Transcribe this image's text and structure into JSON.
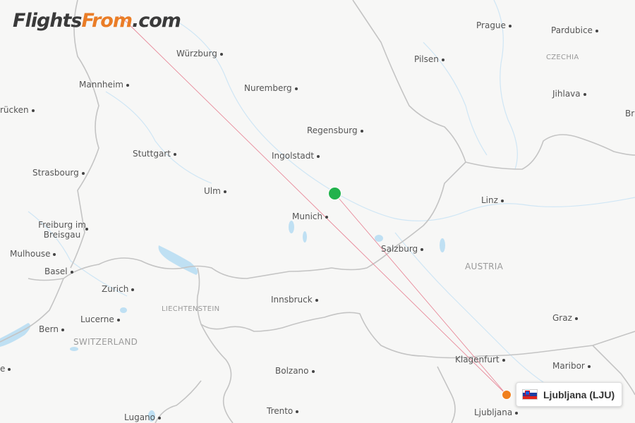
{
  "logo": {
    "part1": "Flights",
    "part2": "From",
    "part3": ".com"
  },
  "cities": [
    {
      "name": "Würzburg"
    },
    {
      "name": "Mannheim"
    },
    {
      "name": "Nuremberg"
    },
    {
      "name": "rücken"
    },
    {
      "name": "Regensburg"
    },
    {
      "name": "Stuttgart"
    },
    {
      "name": "Ingolstadt"
    },
    {
      "name": "Strasbourg"
    },
    {
      "name": "Ulm"
    },
    {
      "name": "Munich"
    },
    {
      "name": "Freiburg im Breisgau"
    },
    {
      "name": "Mulhouse"
    },
    {
      "name": "Basel"
    },
    {
      "name": "Zurich"
    },
    {
      "name": "Lucerne"
    },
    {
      "name": "Bern"
    },
    {
      "name": "Innsbruck"
    },
    {
      "name": "Bolzano"
    },
    {
      "name": "Trento"
    },
    {
      "name": "Lugano"
    },
    {
      "name": "Prague"
    },
    {
      "name": "Pardubice"
    },
    {
      "name": "Pilsen"
    },
    {
      "name": "Jihlava"
    },
    {
      "name": "Linz"
    },
    {
      "name": "Salzburg"
    },
    {
      "name": "Graz"
    },
    {
      "name": "Klagenfurt"
    },
    {
      "name": "Maribor"
    },
    {
      "name": "Ljubljana"
    },
    {
      "name": "Br"
    },
    {
      "name": "e"
    }
  ],
  "countries": [
    {
      "name": "CZECHIA"
    },
    {
      "name": "AUSTRIA"
    },
    {
      "name": "LIECHTENSTEIN"
    },
    {
      "name": "SWITZERLAND"
    }
  ],
  "origin_airport": {
    "label": "Ljubljana (LJU)",
    "marker_color": "#f07f1d",
    "flag": "slovenia-flag"
  },
  "destination_marker_color": "#22b24c",
  "route_color": "#e88a9a"
}
